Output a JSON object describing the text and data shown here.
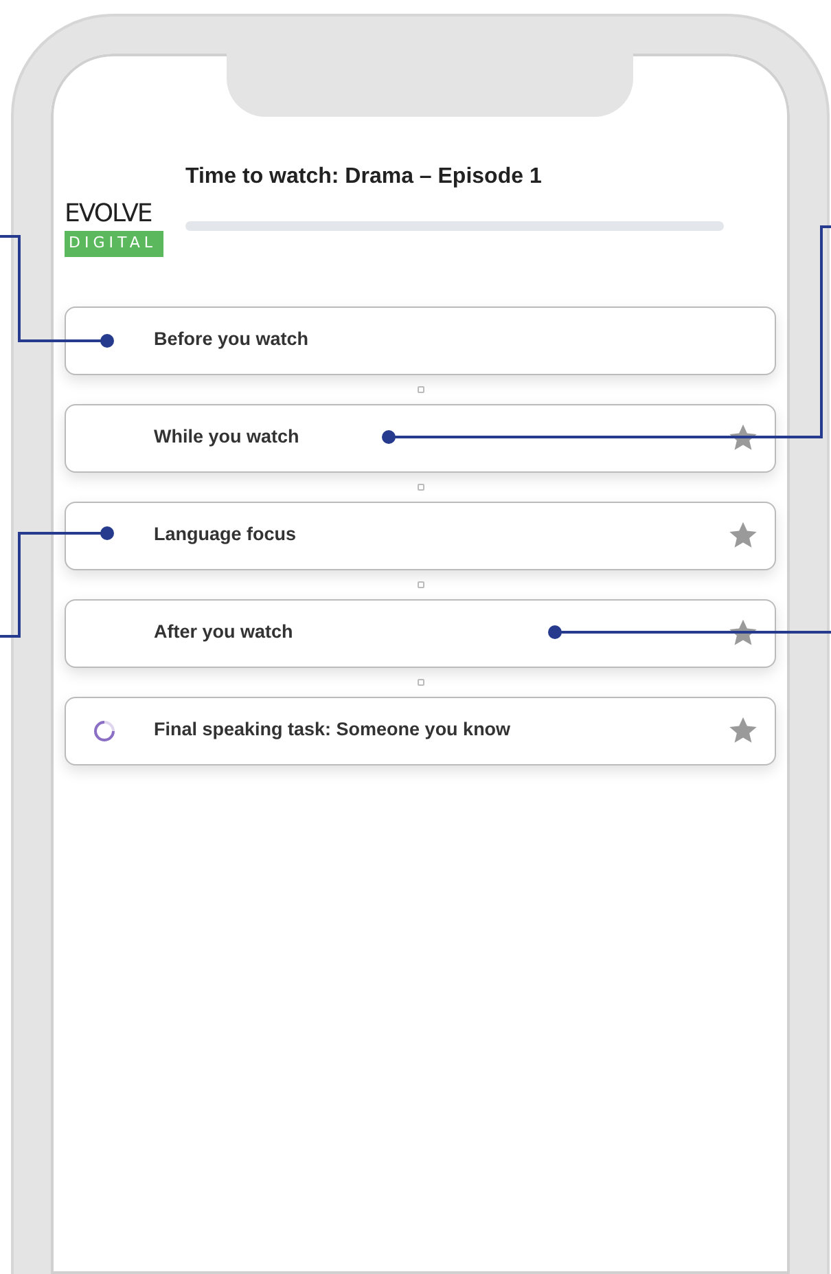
{
  "header": {
    "logo_top": "EVOLVE",
    "logo_bottom": "DIGITAL",
    "title": "Time to watch: Drama – Episode 1",
    "progress": {
      "level": 0
    }
  },
  "items": [
    {
      "label": "Before you watch",
      "star": false,
      "in_progress": false
    },
    {
      "label": "While you watch",
      "star": true,
      "in_progress": false
    },
    {
      "label": "Language focus",
      "star": true,
      "in_progress": false
    },
    {
      "label": "After you watch",
      "star": true,
      "in_progress": false
    },
    {
      "label": "Final speaking task: Someone you know",
      "star": true,
      "in_progress": true
    }
  ]
}
